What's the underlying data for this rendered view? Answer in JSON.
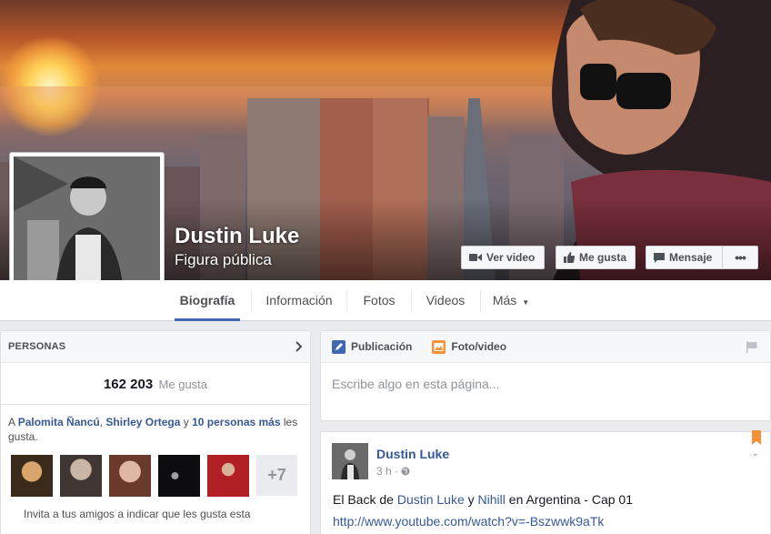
{
  "page": {
    "name": "Dustin Luke",
    "category": "Figura pública"
  },
  "cover_buttons": [
    {
      "label": "Ver video",
      "icon": "video-camera-icon"
    },
    {
      "label": "Me gusta",
      "icon": "thumbs-up-icon"
    },
    {
      "label": "Mensaje",
      "icon": "message-icon"
    },
    {
      "label": "•••",
      "icon": "more-icon"
    }
  ],
  "tabs": [
    {
      "label": "Biografía",
      "active": true
    },
    {
      "label": "Información"
    },
    {
      "label": "Fotos"
    },
    {
      "label": "Videos"
    },
    {
      "label": "Más"
    }
  ],
  "people": {
    "title": "PERSONAS",
    "likes_count": "162 203",
    "likes_label": "Me gusta",
    "friends_prefix": "A",
    "friend1": "Palomita Ñancú",
    "sep": ",",
    "friend2": "Shirley Ortega",
    "and": "y",
    "others": "10 personas más",
    "suffix": "les gusta.",
    "more_count": "+7",
    "invite_text": "Invita a tus amigos a indicar que les gusta esta"
  },
  "composer": {
    "tab_post": "Publicación",
    "tab_photo": "Foto/video",
    "placeholder": "Escribe algo en esta página..."
  },
  "post": {
    "author": "Dustin Luke",
    "time": "3 h",
    "text_prefix": "El Back de",
    "mention1": "Dustin Luke",
    "and": "y",
    "mention2": "Nihill",
    "text_suffix": "en Argentina - Cap 01",
    "link": "http://www.youtube.com/watch?v=-Bszwwk9aTk"
  },
  "colors": {
    "accent": "#4267b2",
    "link": "#365899",
    "bookmark": "#f7923a"
  }
}
